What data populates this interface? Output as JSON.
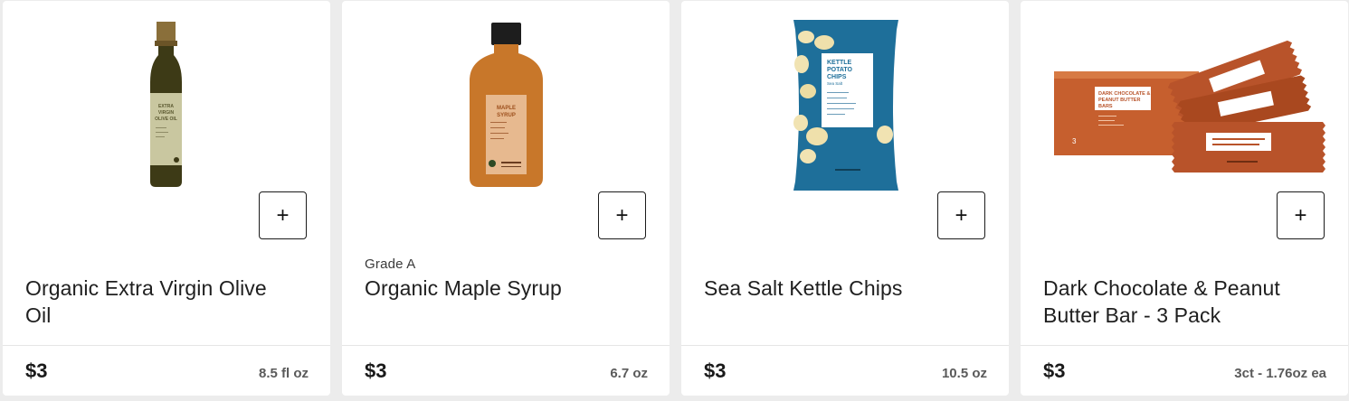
{
  "products": [
    {
      "subtitle": "",
      "name": "Organic Extra Virgin Olive Oil",
      "price": "$3",
      "size": "8.5 fl oz",
      "add_label": "+",
      "image_icon": "olive-oil-bottle",
      "label_text": [
        "EXTRA",
        "VIRGIN",
        "OLIVE OIL"
      ]
    },
    {
      "subtitle": "Grade A",
      "name": "Organic Maple Syrup",
      "price": "$3",
      "size": "6.7 oz",
      "add_label": "+",
      "image_icon": "maple-syrup-bottle",
      "label_text": [
        "MAPLE",
        "SYRUP"
      ]
    },
    {
      "subtitle": "",
      "name": "Sea Salt Kettle Chips",
      "price": "$3",
      "size": "10.5 oz",
      "add_label": "+",
      "image_icon": "chips-bag",
      "label_text": [
        "KETTLE",
        "POTATO",
        "CHIPS",
        "Sea Salt"
      ]
    },
    {
      "subtitle": "",
      "name": "Dark Chocolate & Peanut Butter Bar - 3 Pack",
      "price": "$3",
      "size": "3ct - 1.76oz ea",
      "add_label": "+",
      "image_icon": "snack-bar-box",
      "label_text": [
        "DARK CHOCOLATE &",
        "PEANUT BUTTER",
        "BARS"
      ]
    }
  ],
  "colors": {
    "olive_oil": "#3d3a16",
    "olive_label": "#c9c7a0",
    "maple": "#c8772a",
    "maple_label": "#e7b98f",
    "chips_bag": "#1e6f9a",
    "bar_wrapper": "#b8532a"
  }
}
